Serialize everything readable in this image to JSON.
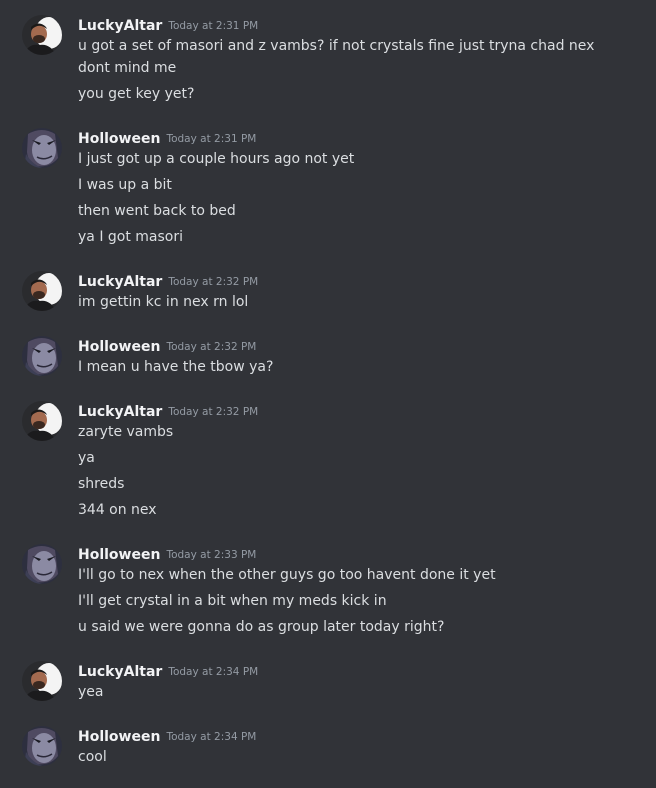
{
  "colors": {
    "background": "#313338",
    "username": "#f2f3f5",
    "text": "#dbdee1",
    "timestamp": "#949ba4"
  },
  "messages": [
    {
      "author": "LuckyAltar",
      "avatar": "lucky-altar-avatar",
      "time": "Today at 2:31 PM",
      "lines": [
        "u got a set of masori and z vambs? if not crystals fine just tryna chad nex",
        "dont mind me",
        "you get key yet?"
      ]
    },
    {
      "author": "Holloween",
      "avatar": "holloween-avatar",
      "time": "Today at 2:31 PM",
      "lines": [
        "I just got up a couple hours ago not yet",
        "I was up a bit",
        "then went back to bed",
        "ya I got masori"
      ]
    },
    {
      "author": "LuckyAltar",
      "avatar": "lucky-altar-avatar",
      "time": "Today at 2:32 PM",
      "lines": [
        "im gettin kc in nex rn lol"
      ]
    },
    {
      "author": "Holloween",
      "avatar": "holloween-avatar",
      "time": "Today at 2:32 PM",
      "lines": [
        "I mean u have the tbow ya?"
      ]
    },
    {
      "author": "LuckyAltar",
      "avatar": "lucky-altar-avatar",
      "time": "Today at 2:32 PM",
      "lines": [
        "zaryte vambs",
        "ya",
        "shreds",
        "344 on nex"
      ]
    },
    {
      "author": "Holloween",
      "avatar": "holloween-avatar",
      "time": "Today at 2:33 PM",
      "lines": [
        "I'll go to nex when the other guys go too havent done it yet",
        "I'll get crystal in a bit when my meds kick in",
        "u said we were gonna do as group later today right?"
      ]
    },
    {
      "author": "LuckyAltar",
      "avatar": "lucky-altar-avatar",
      "time": "Today at 2:34 PM",
      "lines": [
        "yea"
      ]
    },
    {
      "author": "Holloween",
      "avatar": "holloween-avatar",
      "time": "Today at 2:34 PM",
      "lines": [
        "cool"
      ]
    }
  ]
}
